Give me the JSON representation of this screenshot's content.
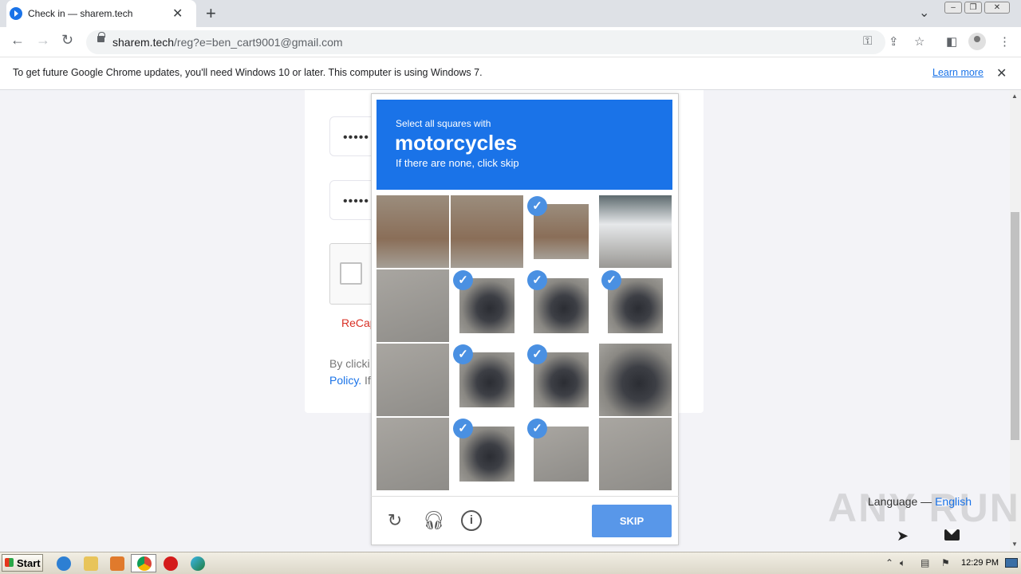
{
  "browser": {
    "tab_title": "Check in — sharem.tech",
    "url_host": "sharem.tech",
    "url_path": "/reg?e=ben_cart9001@gmail.com"
  },
  "infobar": {
    "message": "To get future Google Chrome updates, you'll need Windows 10 or later. This computer is using Windows 7.",
    "learn_more": "Learn more"
  },
  "form": {
    "password_mask_1": "•••••",
    "password_mask_2": "•••••",
    "recaptcha_label": "ReCap",
    "terms_start": "By clicki",
    "policy_link": "Policy.",
    "policy_rest": "If"
  },
  "captcha": {
    "instruction": "Select all squares with",
    "object": "motorcycles",
    "hint": "If there are none, click skip",
    "tiles_selected": [
      false,
      false,
      true,
      false,
      false,
      true,
      true,
      true,
      false,
      true,
      true,
      false,
      false,
      true,
      true,
      false
    ],
    "skip_label": "SKIP",
    "footer_icons": [
      "reload-icon",
      "audio-icon",
      "info-icon"
    ]
  },
  "page_footer": {
    "language_label": "Language —",
    "language_value": "English",
    "watermark": "ANY RUN"
  },
  "taskbar": {
    "start_label": "Start",
    "clock": "12:29 PM"
  },
  "colors": {
    "captcha_header": "#1a73e8",
    "skip_button": "#5897e9",
    "check_badge": "#4a90e2"
  }
}
